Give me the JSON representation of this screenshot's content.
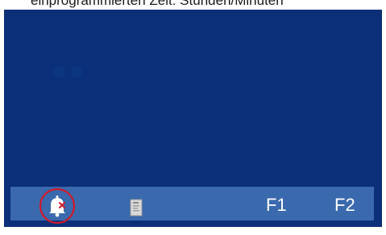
{
  "caption": "einprogrammierten Zeit: Stunden/Minuten",
  "bottom_bar": {
    "bell_icon": "bell-icon",
    "document_icon": "document-icon",
    "f1_label": "F1",
    "f2_label": "F2"
  },
  "colors": {
    "screen_bg": "#0b2f78",
    "bar_bg": "#3a69ad",
    "highlight_circle": "#d01a2a"
  }
}
